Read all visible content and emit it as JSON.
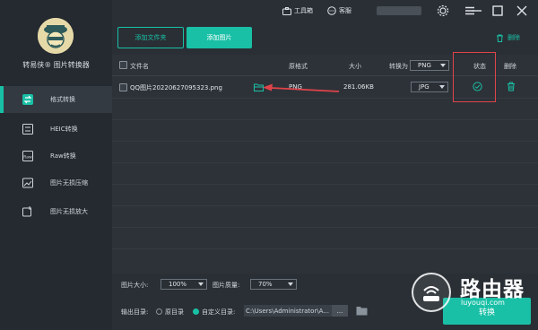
{
  "app": {
    "name": "转易侠® 图片转换器"
  },
  "titlebar": {
    "toolbox": "工具箱",
    "service": "客服"
  },
  "nav": [
    {
      "label": "格式转换",
      "icon": "format-convert-icon",
      "active": true
    },
    {
      "label": "HEIC转换",
      "icon": "heic-icon",
      "active": false
    },
    {
      "label": "Raw转换",
      "icon": "raw-icon",
      "active": false
    },
    {
      "label": "图片无损压缩",
      "icon": "compress-icon",
      "active": false
    },
    {
      "label": "图片无损放大",
      "icon": "enlarge-icon",
      "active": false
    }
  ],
  "actions": {
    "add_folder": "添加文件夹",
    "add_image": "添加图片",
    "delete_all": "删除"
  },
  "table": {
    "headers": {
      "filename": "文件名",
      "orig_format": "原格式",
      "size": "大小",
      "convert_to": "转换为",
      "convert_to_value": "PNG",
      "status": "状态",
      "delete": "删除"
    },
    "rows": [
      {
        "filename": "QQ图片20220627095323.png",
        "orig_format": "PNG",
        "size": "281.06KB",
        "target": "JPG",
        "status": "done"
      }
    ]
  },
  "bottom": {
    "img_size_label": "图片大小:",
    "img_size_value": "100%",
    "img_quality_label": "图片质量:",
    "img_quality_value": "70%",
    "output_label": "输出目录:",
    "orig_dir": "原目录",
    "custom_dir": "自定义目录:",
    "path": "C:\\Users\\Administrator\\A...",
    "browse": "...",
    "convert": "转换"
  },
  "watermark": {
    "text": "路由器",
    "sub": "luyouqi.com"
  },
  "colors": {
    "accent": "#19c0a6",
    "highlight": "#e0434a",
    "arrow": "#e0434a"
  }
}
